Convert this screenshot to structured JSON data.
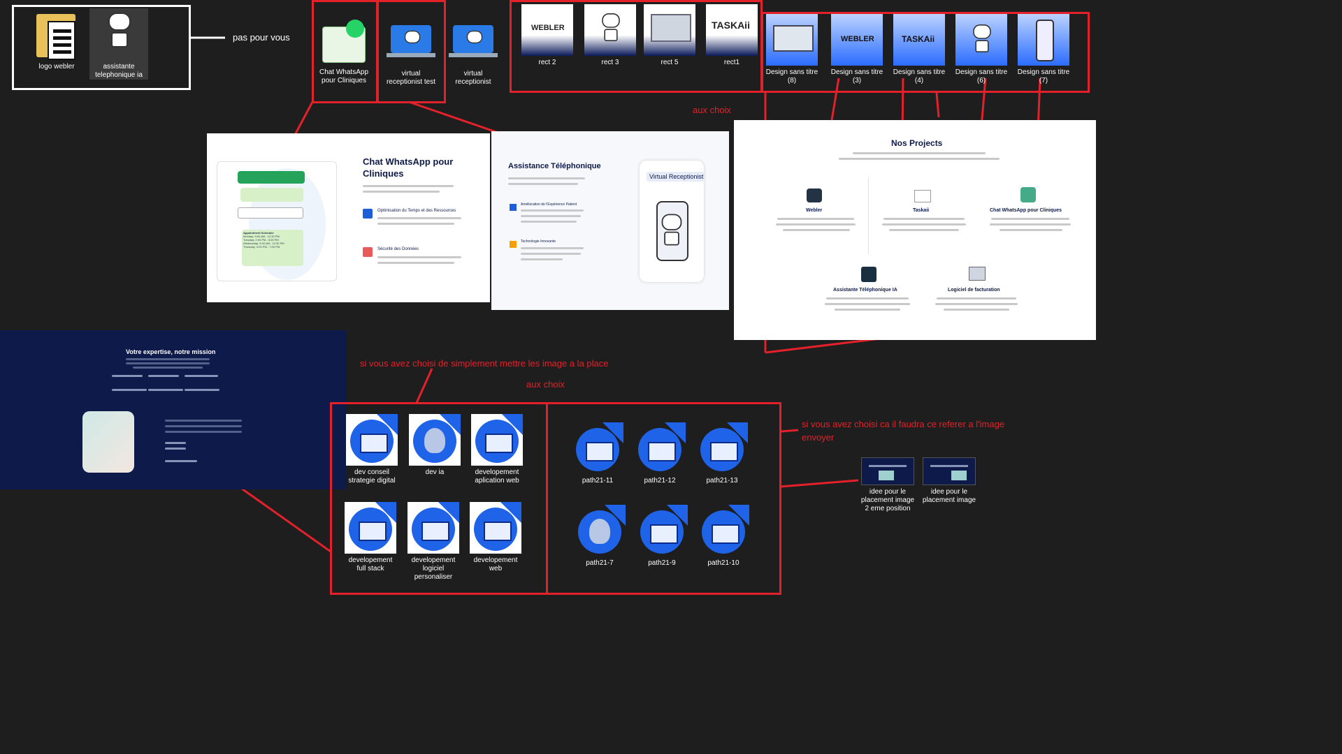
{
  "top_left": {
    "files": [
      {
        "label": "logo webler",
        "icon": "folder-icon"
      },
      {
        "label": "assistante telephonique ia",
        "icon": "robot-icon"
      }
    ],
    "arrow_label": "pas pour vous"
  },
  "chat_group": {
    "files": [
      {
        "label": "Chat WhatsApp pour Cliniques"
      },
      {
        "label": "virtual receptionist test"
      },
      {
        "label": "virtual receptionist"
      }
    ]
  },
  "rect_group": {
    "files": [
      {
        "label": "rect 2"
      },
      {
        "label": "rect 3"
      },
      {
        "label": "rect 5"
      },
      {
        "label": "rect1"
      }
    ]
  },
  "design_group": {
    "files": [
      {
        "label": "Design sans titre (8)"
      },
      {
        "label": "Design sans titre (3)"
      },
      {
        "label": "Design sans titre (4)"
      },
      {
        "label": "Design sans titre (6)"
      },
      {
        "label": "Design sans titre (7)"
      }
    ]
  },
  "annotations": {
    "aux_choix_1": "aux choix",
    "aux_choix_2": "aux choix",
    "simple_images": "si vous avez choisi de simplement mettre les image a la place",
    "refer_image": "si vous avez choisi ca il faudra ce referer a l'image envoyer"
  },
  "slide_whatsapp": {
    "title": "Chat WhatsApp pour Cliniques",
    "feature1": "Optimisation du Temps et des Ressources",
    "feature2": "Sécurité des Données",
    "schedule_title": "Appointment Schedule",
    "schedule": [
      "Monday: 9:00 AM - 12:30 PM",
      "Tuesday: 2:00 PM - 5:00 PM",
      "Wednesday: 9:00 AM - 12:30 PM",
      "Thursday: 3:00 PM - 7:00 PM"
    ]
  },
  "slide_assistance": {
    "title": "Assistance Téléphonique",
    "feature1": "Amélioration de l'Expérience Patient",
    "feature2": "Technologie Innovante",
    "badge": "Virtual Receptionist"
  },
  "projects": {
    "title": "Nos Projects",
    "items": [
      {
        "name": "Webler"
      },
      {
        "name": "Taskaii"
      },
      {
        "name": "Chat WhatsApp pour Cliniques"
      },
      {
        "name": "Assistante Téléphonique IA"
      },
      {
        "name": "Logiciel de facturation"
      }
    ]
  },
  "mission": {
    "title": "Votre expertise, notre mission"
  },
  "simple_group": {
    "files": [
      {
        "label": "dev conseil strategie digital"
      },
      {
        "label": "dev ia"
      },
      {
        "label": "developement aplication web"
      },
      {
        "label": "developement full stack"
      },
      {
        "label": "developement logiciel personaliser"
      },
      {
        "label": "developement web"
      }
    ]
  },
  "path_group": {
    "files": [
      {
        "label": "path21-11"
      },
      {
        "label": "path21-12"
      },
      {
        "label": "path21-13"
      },
      {
        "label": "path21-7"
      },
      {
        "label": "path21-9"
      },
      {
        "label": "path21-10"
      }
    ]
  },
  "idea_group": {
    "files": [
      {
        "label": "idee pour le placement image 2 eme position"
      },
      {
        "label": "idee pour le placement image"
      }
    ]
  },
  "colors": {
    "annotation_red": "#e3212a",
    "background": "#1e1e1e",
    "brand_blue": "#1f63e8",
    "navy": "#0d1a4a"
  }
}
